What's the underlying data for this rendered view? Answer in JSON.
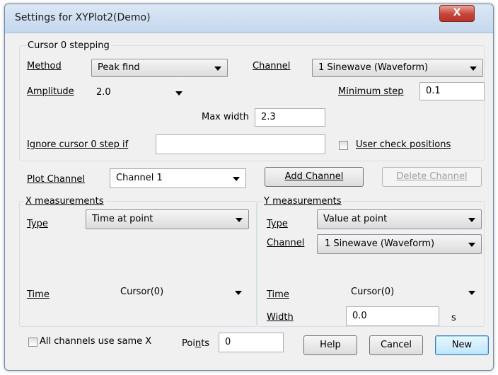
{
  "window": {
    "title": "Settings for XYPlot2(Demo)",
    "close_label": "X"
  },
  "cursor_stepping": {
    "group_label": "Cursor 0 stepping",
    "method_label": "Method",
    "method_value": "Peak find",
    "channel_label": "Channel",
    "channel_value": "1 Sinewave (Waveform)",
    "amplitude_label": "Amplitude",
    "amplitude_value": "2.0",
    "min_step_label": "Minimum step",
    "min_step_value": "0.1",
    "max_width_label": "Max width",
    "max_width_value": "2.3",
    "ignore_label": "Ignore cursor 0 step if",
    "ignore_value": "",
    "user_check_label": "User check positions",
    "user_check_checked": false
  },
  "plot": {
    "plot_channel_label": "Plot Channel",
    "plot_channel_value": "Channel 1",
    "add_channel_label": "Add Channel",
    "delete_channel_label": "Delete Channel"
  },
  "x_measurements": {
    "group_label": "X measurements",
    "type_label": "Type",
    "type_value": "Time at point",
    "time_label": "Time",
    "time_value": "Cursor(0)"
  },
  "y_measurements": {
    "group_label": "Y measurements",
    "type_label": "Type",
    "type_value": "Value at point",
    "channel_label": "Channel",
    "channel_value": "1 Sinewave (Waveform)",
    "time_label": "Time",
    "time_value": "Cursor(0)",
    "width_label": "Width",
    "width_value": "0.0",
    "width_unit": "s"
  },
  "footer": {
    "same_x_label": "All channels use same X",
    "same_x_checked": false,
    "points_label": "Points",
    "points_value": "0",
    "help_label": "Help",
    "cancel_label": "Cancel",
    "new_label": "New"
  }
}
